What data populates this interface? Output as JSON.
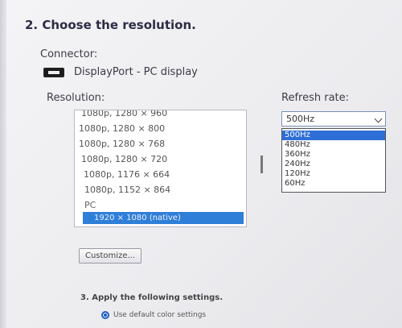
{
  "section": {
    "title": "2. Choose the resolution."
  },
  "connector": {
    "label": "Connector:",
    "value": "DisplayPort - PC display"
  },
  "resolution": {
    "label": "Resolution:",
    "items": [
      "1080p, 1280 × 960",
      "1080p, 1280 × 800",
      "1080p, 1280 × 768",
      "1080p, 1280 × 720",
      "1080p, 1176 × 664",
      "1080p, 1152 × 864"
    ],
    "group": "PC",
    "selected": "1920 × 1080 (native)"
  },
  "refresh": {
    "label": "Refresh rate:",
    "value": "500Hz",
    "options": [
      "500Hz",
      "480Hz",
      "360Hz",
      "240Hz",
      "120Hz",
      "60Hz"
    ]
  },
  "buttons": {
    "customize": "Customize..."
  },
  "apply": {
    "title": "3. Apply the following settings.",
    "radio_label": "Use default color settings"
  }
}
